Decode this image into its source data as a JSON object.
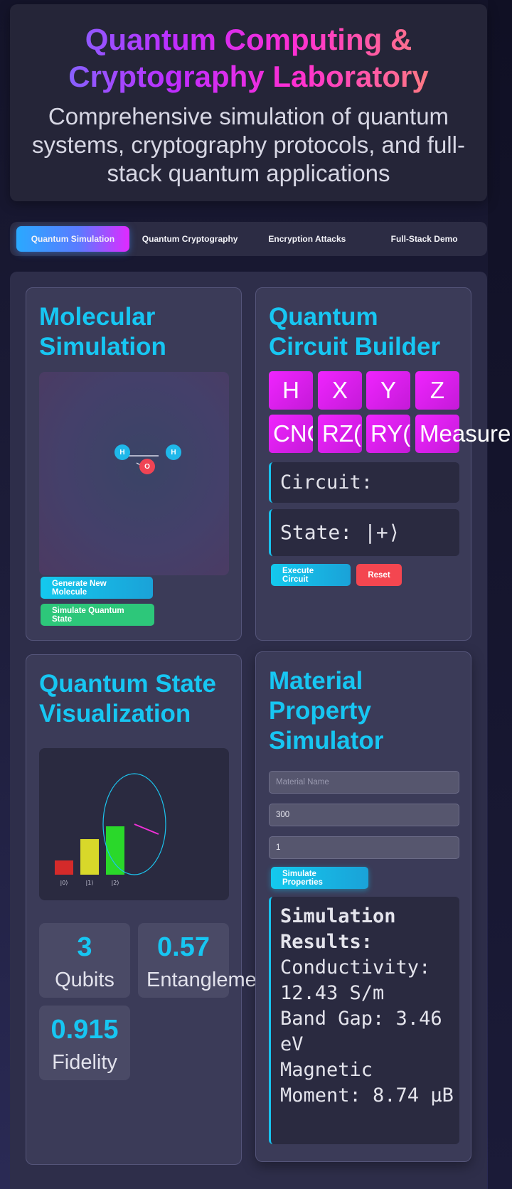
{
  "header": {
    "title": "Quantum Computing & Cryptography Laboratory",
    "subtitle": "Comprehensive simulation of quantum systems, cryptography protocols, and full-stack quantum applications"
  },
  "tabs": [
    {
      "label": "Quantum Simulation",
      "active": true
    },
    {
      "label": "Quantum Cryptography",
      "active": false
    },
    {
      "label": "Encryption Attacks",
      "active": false
    },
    {
      "label": "Full-Stack Demo",
      "active": false
    }
  ],
  "molecular": {
    "title": "Molecular Simulation",
    "atoms": [
      "H",
      "H",
      "O"
    ],
    "generate_label": "Generate New Molecule",
    "simulate_label": "Simulate Quantum State"
  },
  "circuit": {
    "title": "Quantum Circuit Builder",
    "gates": [
      "H",
      "X",
      "Y",
      "Z",
      "CNOT",
      "RZ(θ)",
      "RY(θ)",
      "Measure"
    ],
    "circuit_text": "Circuit:",
    "state_text": "State: |+⟩",
    "execute_label": "Execute Circuit",
    "reset_label": "Reset"
  },
  "visualization": {
    "title": "Quantum State Visualization",
    "bar_labels": [
      "|0⟩",
      "|1⟩",
      "|2⟩"
    ],
    "bar_colors": [
      "#d42a2a",
      "#d8d82a",
      "#2ad82a"
    ],
    "stats": [
      {
        "value": "3",
        "label": "Qubits"
      },
      {
        "value": "0.57",
        "label": "Entanglement"
      },
      {
        "value": "0.915",
        "label": "Fidelity"
      }
    ]
  },
  "material": {
    "title": "Material Property Simulator",
    "name_placeholder": "Material Name",
    "temperature_value": "300",
    "pressure_value": "1",
    "simulate_label": "Simulate Properties",
    "results_heading": "Simulation Results:",
    "results_lines": [
      "Conductivity: 12.43 S/m",
      "Band Gap: 3.46 eV",
      "Magnetic Moment: 8.74 μB"
    ]
  },
  "colors": {
    "accent": "#17c6f2",
    "gate": "#e020f5",
    "success": "#2dc77a",
    "danger": "#f44650"
  }
}
